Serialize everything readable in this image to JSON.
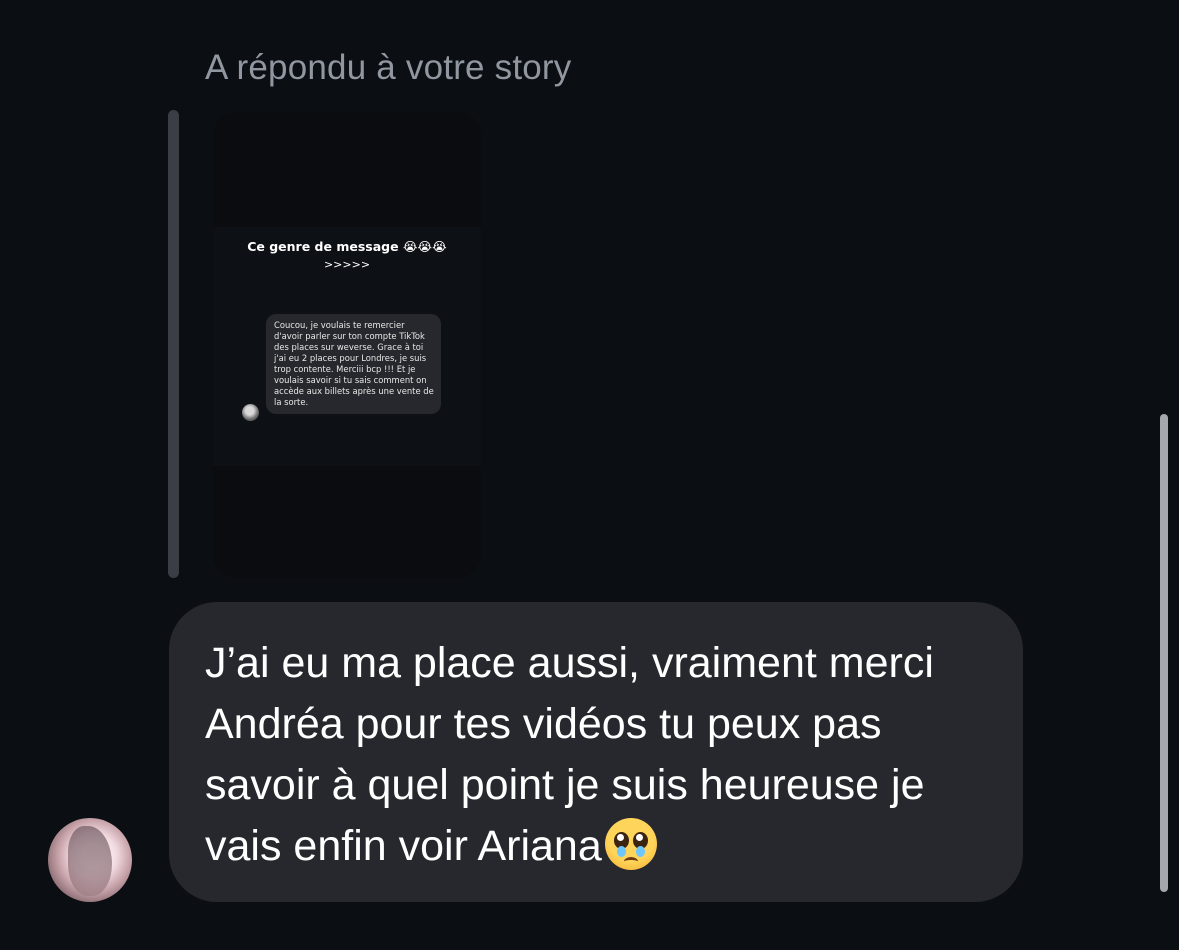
{
  "conversation": {
    "reply_label": "A répondu à votre story",
    "story": {
      "caption_line1": "Ce genre de message 😭😭😭",
      "caption_line2": ">>>>>",
      "quoted_message": "Coucou, je voulais te remercier d'avoir parler sur ton compte TikTok des places sur weverse. Grace à toi j'ai eu 2 places pour Londres, je suis trop contente. Merciii bcp !!! Et je voulais savoir si tu sais comment on accède aux billets après une vente de la sorte."
    },
    "message": {
      "text": "J’ai eu ma place aussi, vraiment merci Andréa pour tes vidéos tu peux pas savoir à quel point je suis heureuse je vais enfin voir Ariana",
      "emoji_icon": "pleading-face-icon"
    }
  },
  "colors": {
    "background": "#0b0e12",
    "bubble": "#26282d",
    "label": "#9197a0",
    "text": "#ffffff"
  }
}
